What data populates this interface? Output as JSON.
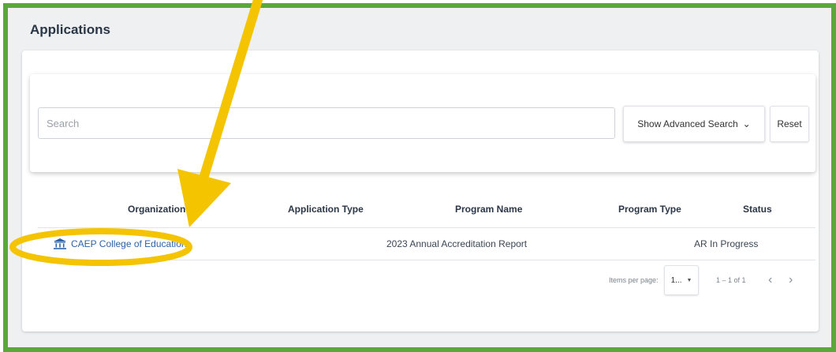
{
  "page": {
    "title": "Applications"
  },
  "search": {
    "placeholder": "Search",
    "advanced_label": "Show Advanced Search",
    "reset_label": "Reset"
  },
  "table": {
    "columns": [
      "Organization",
      "Application Type",
      "Program Name",
      "Program Type",
      "Status"
    ],
    "rows": [
      {
        "organization": "CAEP College of Education",
        "application_type": "",
        "program_name": "2023 Annual Accreditation Report",
        "program_type": "",
        "status": "AR In Progress"
      }
    ]
  },
  "pagination": {
    "items_per_page_label": "Items per page:",
    "items_per_page_value": "1...",
    "range": "1 – 1 of 1"
  },
  "colors": {
    "frame_border": "#5aa83a",
    "annotation": "#f5c400",
    "link": "#2e62a8"
  }
}
